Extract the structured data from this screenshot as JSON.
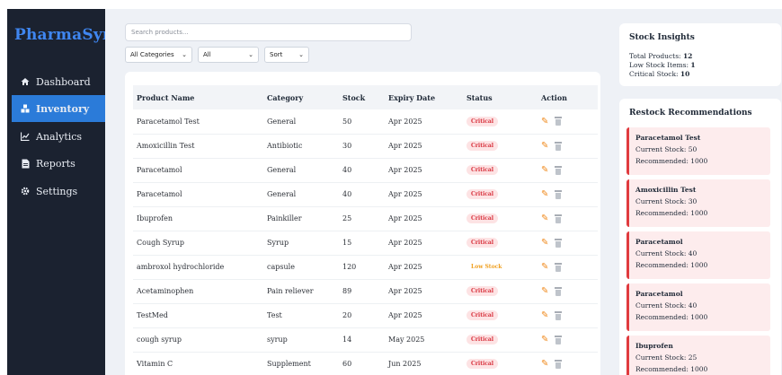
{
  "brand": "PharmaSync",
  "nav": [
    {
      "label": "Dashboard",
      "icon": "home-icon",
      "active": false
    },
    {
      "label": "Inventory",
      "icon": "boxes-icon",
      "active": true
    },
    {
      "label": "Analytics",
      "icon": "line-chart-icon",
      "active": false
    },
    {
      "label": "Reports",
      "icon": "file-icon",
      "active": false
    },
    {
      "label": "Settings",
      "icon": "gear-icon",
      "active": false
    }
  ],
  "search": {
    "placeholder": "Search products..."
  },
  "filters": {
    "category": "All Categories",
    "status": "All",
    "sort": "Sort"
  },
  "table": {
    "headers": [
      "Product Name",
      "Category",
      "Stock",
      "Expiry Date",
      "Status",
      "Action"
    ],
    "rows": [
      {
        "name": "Paracetamol Test",
        "category": "General",
        "stock": "50",
        "expiry": "Apr 2025",
        "status": "Critical"
      },
      {
        "name": "Amoxicillin Test",
        "category": "Antibiotic",
        "stock": "30",
        "expiry": "Apr 2025",
        "status": "Critical"
      },
      {
        "name": "Paracetamol",
        "category": "General",
        "stock": "40",
        "expiry": "Apr 2025",
        "status": "Critical"
      },
      {
        "name": "Paracetamol",
        "category": "General",
        "stock": "40",
        "expiry": "Apr 2025",
        "status": "Critical"
      },
      {
        "name": "Ibuprofen",
        "category": "Painkiller",
        "stock": "25",
        "expiry": "Apr 2025",
        "status": "Critical"
      },
      {
        "name": "Cough Syrup",
        "category": "Syrup",
        "stock": "15",
        "expiry": "Apr 2025",
        "status": "Critical"
      },
      {
        "name": "ambroxol hydrochloride",
        "category": "capsule",
        "stock": "120",
        "expiry": "Apr 2025",
        "status": "Low Stock"
      },
      {
        "name": "Acetaminophen",
        "category": "Pain reliever",
        "stock": "89",
        "expiry": "Apr 2025",
        "status": "Critical"
      },
      {
        "name": "TestMed",
        "category": "Test",
        "stock": "20",
        "expiry": "Apr 2025",
        "status": "Critical"
      },
      {
        "name": "cough syrup",
        "category": "syrup",
        "stock": "14",
        "expiry": "May 2025",
        "status": "Critical"
      },
      {
        "name": "Vitamin C",
        "category": "Supplement",
        "stock": "60",
        "expiry": "Jun 2025",
        "status": "Critical"
      }
    ]
  },
  "insights": {
    "title": "Stock Insights",
    "total_label": "Total Products:",
    "total": "12",
    "low_label": "Low Stock Items:",
    "low": "1",
    "critical_label": "Critical Stock:",
    "critical": "10"
  },
  "restock": {
    "title": "Restock Recommendations",
    "items": [
      {
        "name": "Paracetamol Test",
        "current": "Current Stock: 50",
        "recommended": "Recommended: 1000"
      },
      {
        "name": "Amoxicillin Test",
        "current": "Current Stock: 30",
        "recommended": "Recommended: 1000"
      },
      {
        "name": "Paracetamol",
        "current": "Current Stock: 40",
        "recommended": "Recommended: 1000"
      },
      {
        "name": "Paracetamol",
        "current": "Current Stock: 40",
        "recommended": "Recommended: 1000"
      },
      {
        "name": "Ibuprofen",
        "current": "Current Stock: 25",
        "recommended": "Recommended: 1000"
      }
    ]
  },
  "colors": {
    "sidebar": "#1b2230",
    "accent": "#2b7bd9",
    "brand": "#3f86f0",
    "critical": "#d8313c",
    "low": "#f0a020"
  }
}
